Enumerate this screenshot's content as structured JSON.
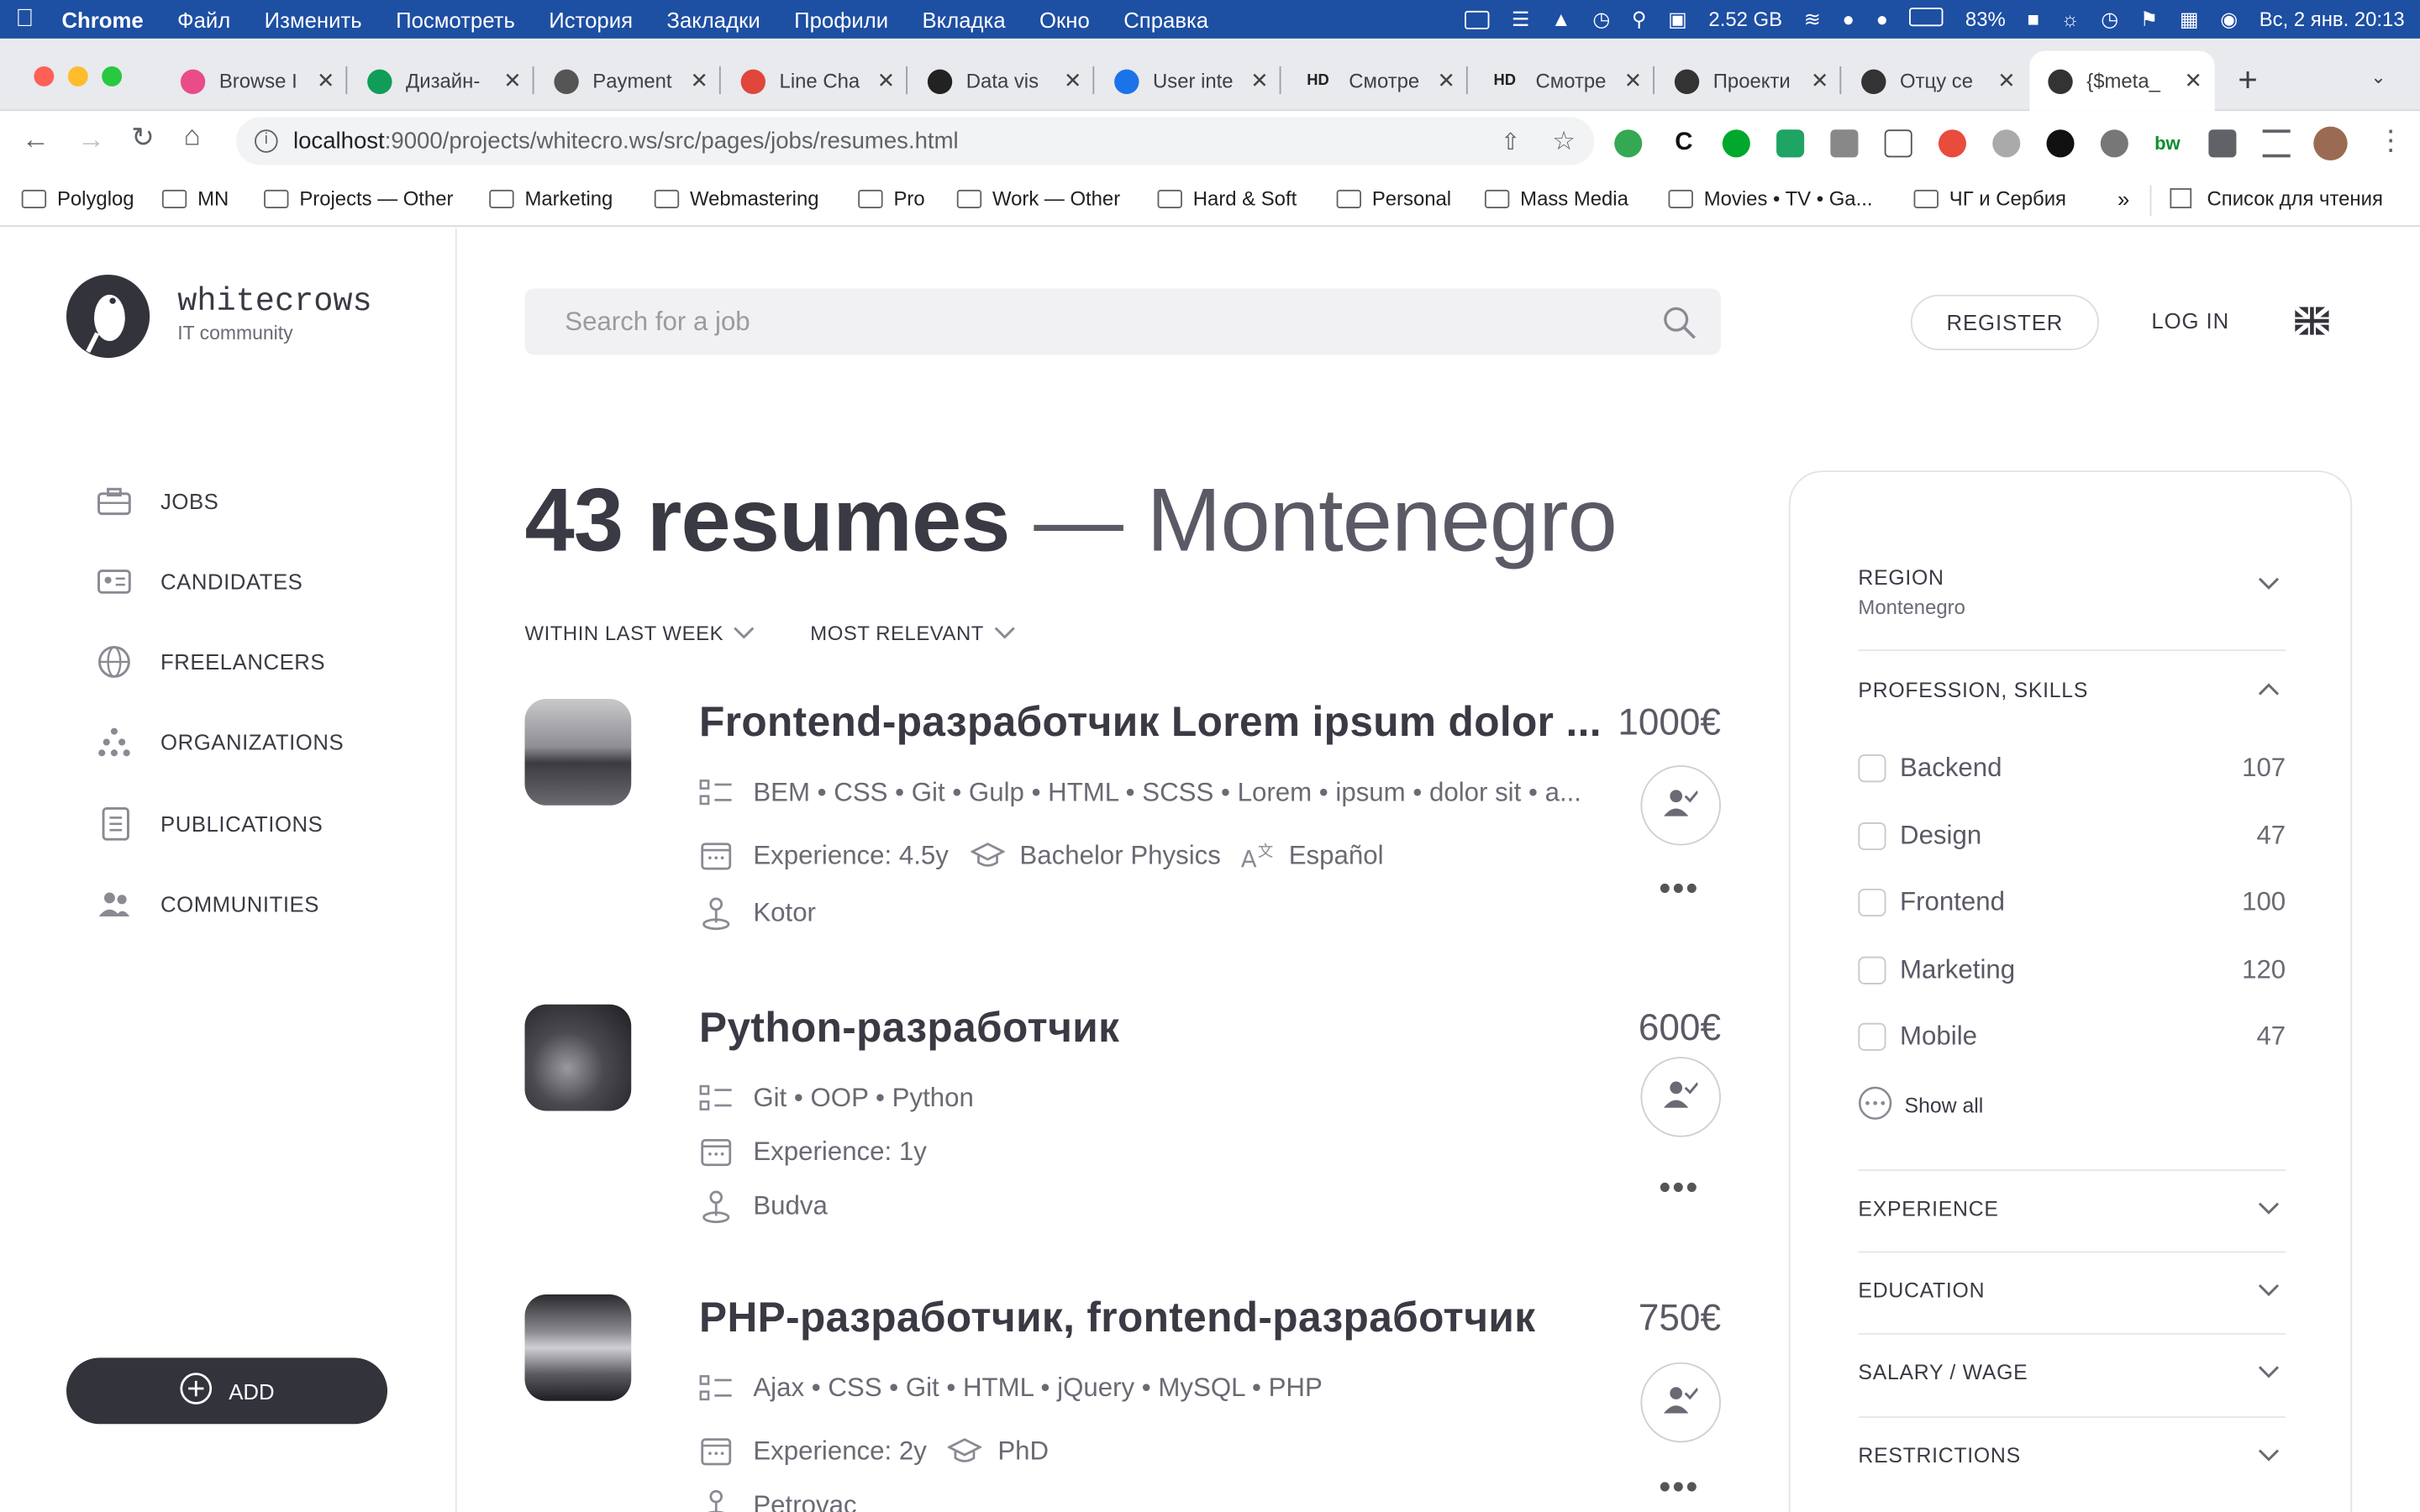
{
  "menubar": {
    "items": [
      "Chrome",
      "Файл",
      "Изменить",
      "Посмотреть",
      "История",
      "Закладки",
      "Профили",
      "Вкладка",
      "Окно",
      "Справка"
    ],
    "memory": "2.52 GB",
    "battery": "83%",
    "datetime": "Вс, 2 янв.  20:13"
  },
  "tabs": [
    {
      "title": "Browse I",
      "icon": "dribbble-icon",
      "color": "#ea4c89"
    },
    {
      "title": "Дизайн-",
      "icon": "sheets-icon",
      "color": "#0f9d58"
    },
    {
      "title": "Payment",
      "icon": "cube-icon",
      "color": "#555555"
    },
    {
      "title": "Line Cha",
      "icon": "chart-icon",
      "color": "#e0463b"
    },
    {
      "title": "Data vis",
      "icon": "github-icon",
      "color": "#222222"
    },
    {
      "title": "User inte",
      "icon": "terminal-icon",
      "color": "#1a73e8"
    },
    {
      "title": "Смотре",
      "icon": "hd-icon",
      "color": "#222222",
      "label": "HD"
    },
    {
      "title": "Смотре",
      "icon": "hd-icon",
      "color": "#222222",
      "label": "HD"
    },
    {
      "title": "Проекти",
      "icon": "tilda-icon",
      "color": "#333333"
    },
    {
      "title": "Отцу се",
      "icon": "tilda-icon",
      "color": "#333333"
    },
    {
      "title": "{$meta_",
      "icon": "bird-icon",
      "color": "#333333"
    }
  ],
  "address": {
    "host": "localhost",
    "rest": ":9000/projects/whitecro.ws/src/pages/jobs/resumes.html"
  },
  "bookmarks": [
    "Polyglog",
    "MN",
    "Projects — Other",
    "Marketing",
    "Webmastering",
    "Pro",
    "Work — Other",
    "Hard & Soft",
    "Personal",
    "Mass Media",
    "Movies • TV • Ga...",
    "ЧГ и Сербия"
  ],
  "bookmarks_more": "»",
  "reading_list": "Список для чтения",
  "brand": {
    "name": "whitecrows",
    "tagline": "IT community"
  },
  "nav": [
    "JOBS",
    "CANDIDATES",
    "FREELANCERS",
    "ORGANIZATIONS",
    "PUBLICATIONS",
    "COMMUNITIES"
  ],
  "add_label": "ADD",
  "search_placeholder": "Search for a job",
  "register_label": "REGISTER",
  "login_label": "LOG IN",
  "heading": {
    "count": "43 resumes",
    "dash": " — ",
    "region": "Montenegro"
  },
  "sort": {
    "period": "WITHIN LAST WEEK",
    "order": "MOST RELEVANT"
  },
  "resumes": [
    {
      "title": "Frontend-разработчик Lorem ipsum dolor ...",
      "price": "1000€",
      "skills": "BEM • CSS • Git • Gulp • HTML • SCSS • Lorem • ipsum • dolor sit • a...",
      "experience": "Experience: 4.5y",
      "education": "Bachelor Physics",
      "language": "Español",
      "city": "Kotor"
    },
    {
      "title": "Python-разработчик",
      "price": "600€",
      "skills": "Git • OOP • Python",
      "experience": "Experience: 1y",
      "city": "Budva"
    },
    {
      "title": "PHP-разработчик, frontend-разработчик",
      "price": "750€",
      "skills": "Ajax • CSS • Git • HTML • jQuery • MySQL • PHP",
      "experience": "Experience: 2y",
      "education": "PhD",
      "city": "Petrovac"
    }
  ],
  "filters": {
    "region_label": "REGION",
    "region_value": "Montenegro",
    "profession_label": "PROFESSION, SKILLS",
    "profession_items": [
      {
        "label": "Backend",
        "count": "107"
      },
      {
        "label": "Design",
        "count": "47"
      },
      {
        "label": "Frontend",
        "count": "100"
      },
      {
        "label": "Marketing",
        "count": "120"
      },
      {
        "label": "Mobile",
        "count": "47"
      }
    ],
    "show_all": "Show all",
    "sections": [
      "EXPERIENCE",
      "EDUCATION",
      "SALARY / WAGE",
      "RESTRICTIONS"
    ]
  }
}
